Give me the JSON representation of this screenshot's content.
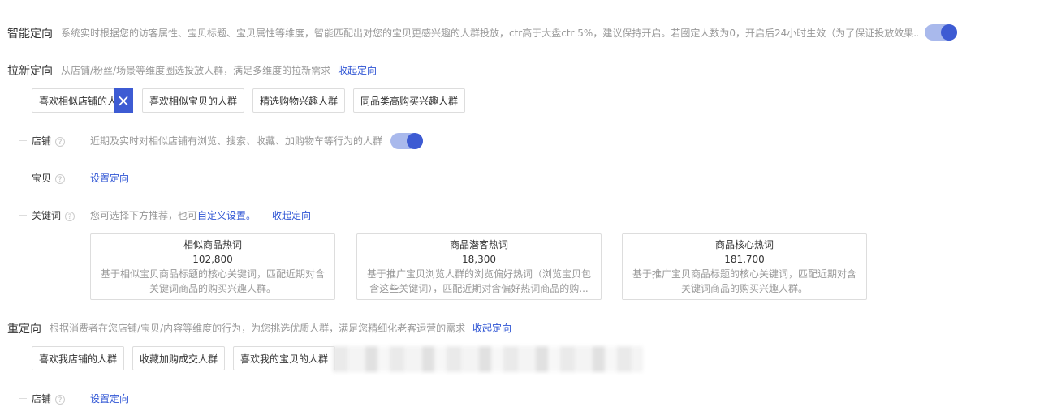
{
  "smart": {
    "title": "智能定向",
    "desc": "系统实时根据您的访客属性、宝贝标题、宝贝属性等维度，智能匹配出对您的宝贝更感兴趣的人群投放，ctr高于大盘ctr 5%，建议保持开启。若圈定人数为0，开启后24小时生效（为了保证投放效果...",
    "toggle_on": true
  },
  "lax": {
    "title": "拉新定向",
    "desc": "从店铺/粉丝/场景等维度圈选投放人群，满足多维度的拉新需求",
    "collapse": "收起定向",
    "chips": [
      "喜欢相似店铺的人群",
      "喜欢相似宝贝的人群",
      "精选购物兴趣人群",
      "同品类高购买兴趣人群"
    ],
    "shop_label": "店铺",
    "shop_desc": "近期及实时对相似店铺有浏览、搜索、收藏、加购物车等行为的人群",
    "shop_toggle_on": true,
    "baby_label": "宝贝",
    "baby_link": "设置定向",
    "kw_label": "关键词",
    "kw_desc": "您可选择下方推荐，也可",
    "kw_custom": "自定义设置。",
    "kw_collapse": "收起定向",
    "cards": [
      {
        "title": "相似商品热词",
        "count": "102,800",
        "desc": "基于相似宝贝商品标题的核心关键词，匹配近期对含关键词商品的购买兴趣人群。"
      },
      {
        "title": "商品潜客热词",
        "count": "18,300",
        "desc": "基于推广宝贝浏览人群的浏览偏好热词（浏览宝贝包含这些关键词），匹配近期对含偏好热词商品的购..."
      },
      {
        "title": "商品核心热词",
        "count": "181,700",
        "desc": "基于推广宝贝商品标题的核心关键词，匹配近期对含关键词商品的购买兴趣人群。"
      }
    ]
  },
  "re": {
    "title": "重定向",
    "desc": "根据消费者在您店铺/宝贝/内容等维度的行为，为您挑选优质人群，满足您精细化老客运营的需求",
    "collapse": "收起定向",
    "chips": [
      "喜欢我店铺的人群",
      "收藏加购成交人群",
      "喜欢我的宝贝的人群"
    ],
    "shop_label": "店铺",
    "shop_link": "设置定向"
  },
  "icons": {
    "help": "question-circle-icon",
    "close": "close-icon"
  },
  "colors": {
    "accent": "#3d5bd3",
    "toggle_track": "#a9b9ec",
    "link": "#2f55d4"
  }
}
